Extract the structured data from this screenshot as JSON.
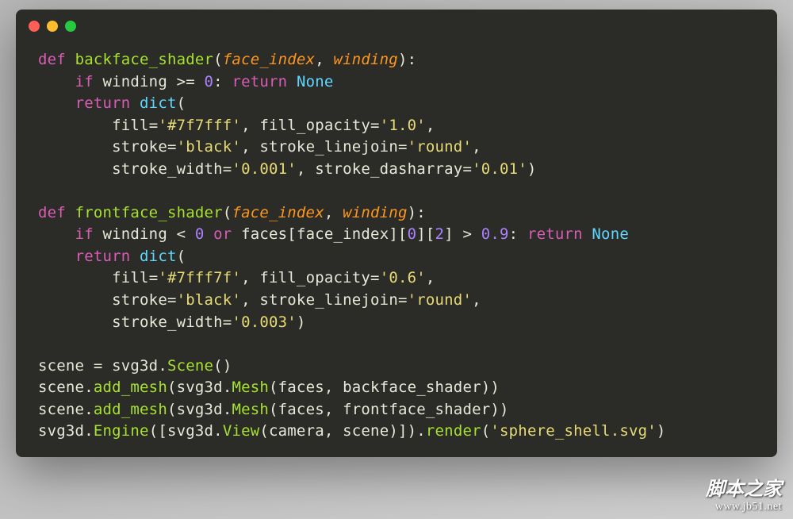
{
  "window": {
    "traffic_lights": {
      "red": "#ff5f56",
      "yellow": "#ffbd2e",
      "green": "#27c93f"
    }
  },
  "code": {
    "kw_def": "def",
    "kw_if": "if",
    "kw_return": "return",
    "kw_or": "or",
    "bi_none": "None",
    "bi_dict": "dict",
    "fn_backface": "backface_shader",
    "fn_frontface": "frontface_shader",
    "param_face_index": "face_index",
    "param_winding": "winding",
    "id_winding": "winding",
    "id_faces": "faces",
    "id_face_index": "face_index",
    "id_scene": "scene",
    "id_svg3d": "svg3d",
    "id_camera": "camera",
    "meth_scene": "Scene",
    "meth_add_mesh": "add_mesh",
    "meth_mesh": "Mesh",
    "meth_engine": "Engine",
    "meth_view": "View",
    "meth_render": "render",
    "n0": "0",
    "n2": "2",
    "n09": "0.9",
    "op_ge": ">=",
    "op_lt": "<",
    "op_gt": ">",
    "op_eq": "=",
    "op_colon": ":",
    "op_dot": ".",
    "op_comma": ",",
    "op_lpar": "(",
    "op_rpar": ")",
    "op_lbr": "[",
    "op_rbr": "]",
    "kwarg_fill": "fill",
    "kwarg_fill_opacity": "fill_opacity",
    "kwarg_stroke": "stroke",
    "kwarg_stroke_linejoin": "stroke_linejoin",
    "kwarg_stroke_width": "stroke_width",
    "kwarg_stroke_dasharray": "stroke_dasharray",
    "s_fill1": "'#7f7fff'",
    "s_fo1": "'1.0'",
    "s_black": "'black'",
    "s_round": "'round'",
    "s_sw001": "'0.001'",
    "s_sd001": "'0.01'",
    "s_fill2": "'#7fff7f'",
    "s_fo06": "'0.6'",
    "s_sw003": "'0.003'",
    "s_sphere": "'sphere_shell.svg'"
  },
  "watermark": {
    "cn": "脚本之家",
    "url": "www.jb51.net"
  }
}
